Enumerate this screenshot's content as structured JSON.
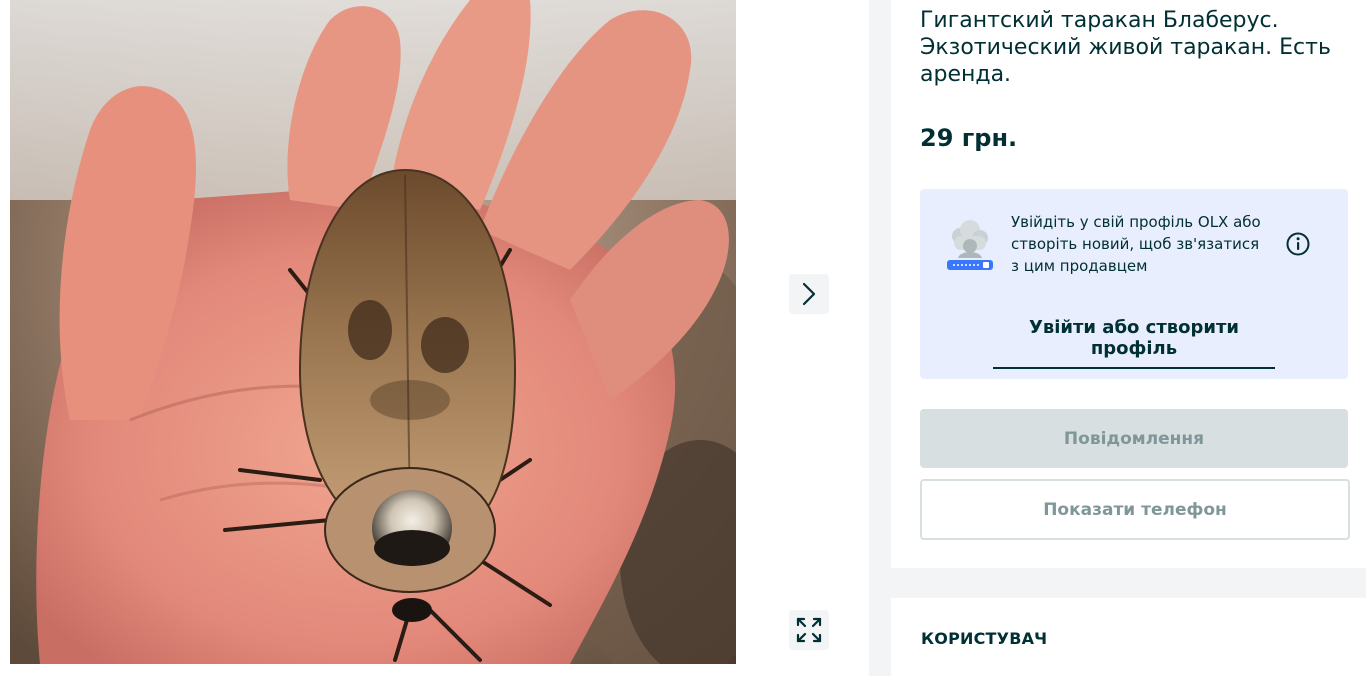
{
  "listing": {
    "title": "Гигантский таракан Блаберус. Экзотический живой таракан. Есть аренда.",
    "price": "29 грн."
  },
  "gallery": {
    "photo_subject": "Giant Blaberus cockroach on an open palm",
    "next_icon": "chevron-right-icon",
    "fullscreen_icon": "expand-arrows-icon"
  },
  "login_prompt": {
    "text": "Увійдіть у свій профіль OLX або створіть новий, щоб зв'язатися з цим продавцем",
    "link_label": "Увійти або створити профіль",
    "info_icon": "info-icon"
  },
  "actions": {
    "message_label": "Повідомлення",
    "phone_label": "Показати телефон"
  },
  "seller": {
    "heading": "КОРИСТУВАЧ"
  },
  "colors": {
    "text": "#002f34",
    "login_bg": "#e8eefe",
    "disabled_btn": "#d8dfe0",
    "disabled_text": "#7f9799",
    "page_bg": "#f2f4f5"
  }
}
